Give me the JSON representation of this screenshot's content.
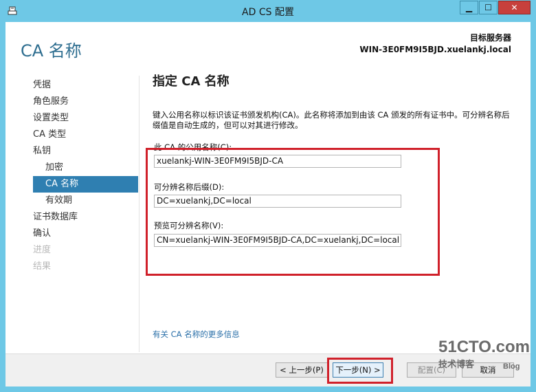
{
  "window": {
    "title": "AD CS 配置",
    "controls": {
      "minimize": "▁",
      "maximize": "☐",
      "close": "✕"
    }
  },
  "header": {
    "page_title": "CA 名称",
    "target_label": "目标服务器",
    "target_server": "WIN-3E0FM9I5BJD.xuelankj.local"
  },
  "nav": {
    "items": [
      {
        "label": "凭据"
      },
      {
        "label": "角色服务"
      },
      {
        "label": "设置类型"
      },
      {
        "label": "CA 类型"
      },
      {
        "label": "私钥"
      },
      {
        "label": "加密"
      },
      {
        "label": "CA 名称"
      },
      {
        "label": "有效期"
      },
      {
        "label": "证书数据库"
      },
      {
        "label": "确认"
      },
      {
        "label": "进度"
      },
      {
        "label": "结果"
      }
    ]
  },
  "content": {
    "title": "指定 CA 名称",
    "description": "键入公用名称以标识该证书颁发机构(CA)。此名称将添加到由该 CA 颁发的所有证书中。可分辨名称后缀值是自动生成的，但可以对其进行修改。",
    "common_name_label": "此 CA 的公用名称(C):",
    "common_name_value": "xuelankj-WIN-3E0FM9I5BJD-CA",
    "dn_suffix_label": "可分辨名称后缀(D):",
    "dn_suffix_value": "DC=xuelankj,DC=local",
    "preview_label": "预览可分辨名称(V):",
    "preview_value": "CN=xuelankj-WIN-3E0FM9I5BJD-CA,DC=xuelankj,DC=local",
    "more_info_link": "有关 CA 名称的更多信息"
  },
  "footer": {
    "prev_label": "< 上一步(P)",
    "next_label": "下一步(N) >",
    "configure_label": "配置(C)",
    "cancel_label": "取消"
  },
  "watermark": {
    "top": "51CTO.com",
    "bottom": "技术博客",
    "blog": "Blog"
  },
  "colors": {
    "titlebar": "#6ec8e6",
    "accent": "#2f7fb1",
    "highlight": "#d0202a",
    "close_button": "#c7403c"
  }
}
